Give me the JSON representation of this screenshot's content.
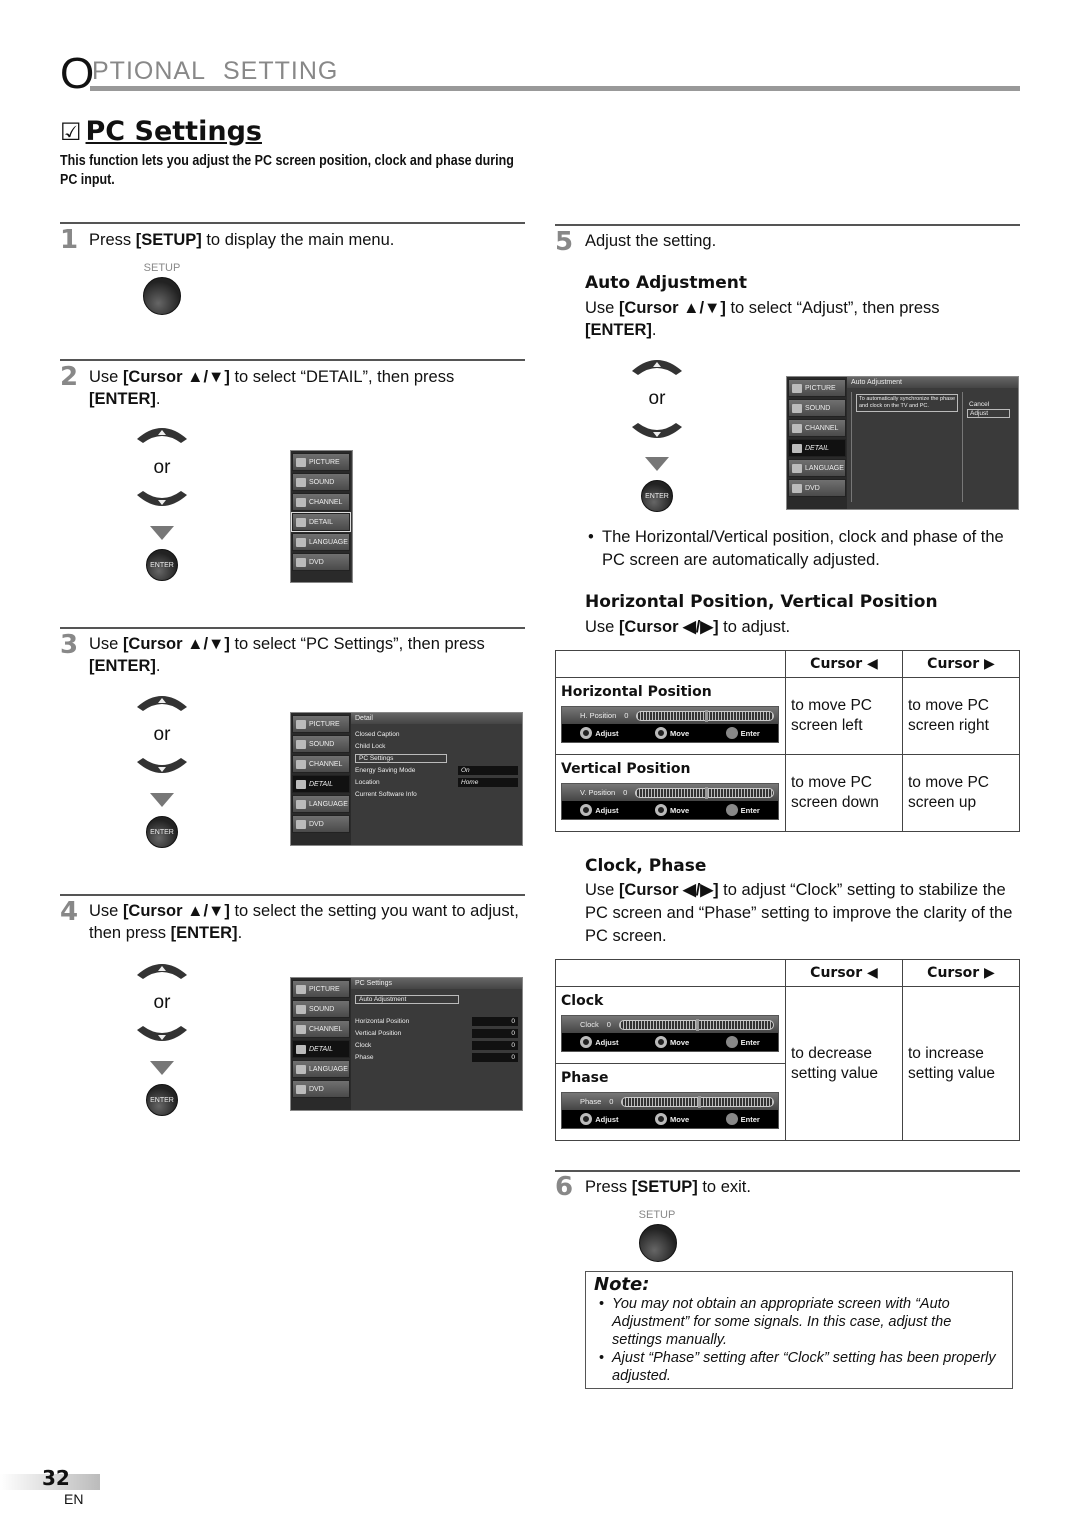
{
  "header": {
    "section_initial": "O",
    "section_rest": "PTIONAL SETTING"
  },
  "page": {
    "title_check": "☑",
    "title": "PC Settings",
    "intro": "This function lets you adjust the PC screen position, clock and phase during PC input.",
    "number": "32",
    "language": "EN"
  },
  "remote": {
    "setup_label": "SETUP",
    "or": "or",
    "enter_label": "ENTER"
  },
  "steps": [
    {
      "num": "1",
      "pre": "Press ",
      "key": "[SETUP]",
      "post": " to display the main menu."
    },
    {
      "num": "2",
      "pre": "Use ",
      "key": "[Cursor ▲/▼]",
      "post": " to select “DETAIL”, then press ",
      "key2": "[ENTER]",
      "post2": "."
    },
    {
      "num": "3",
      "pre": "Use ",
      "key": "[Cursor ▲/▼]",
      "post": " to select “PC Settings”, then press ",
      "key2": "[ENTER]",
      "post2": "."
    },
    {
      "num": "4",
      "pre": "Use ",
      "key": "[Cursor ▲/▼]",
      "post": " to select the setting you want to adjust, then press ",
      "key2": "[ENTER]",
      "post2": "."
    },
    {
      "num": "5",
      "text": "Adjust the setting."
    },
    {
      "num": "6",
      "pre": "Press ",
      "key": "[SETUP]",
      "post": " to exit."
    }
  ],
  "tv_menu": {
    "side": [
      "PICTURE",
      "SOUND",
      "CHANNEL",
      "DETAIL",
      "LANGUAGE",
      "DVD"
    ],
    "detail": {
      "title": "Detail",
      "items": [
        "Closed Caption",
        "Child Lock",
        "PC Settings",
        "Energy Saving Mode",
        "Location",
        "Current Software Info"
      ],
      "energy_value": "On",
      "location_value": "Home"
    },
    "pc_settings": {
      "title": "PC Settings",
      "auto": "Auto Adjustment",
      "rows": [
        {
          "label": "Horizontal Position",
          "value": "0"
        },
        {
          "label": "Vertical Position",
          "value": "0"
        },
        {
          "label": "Clock",
          "value": "0"
        },
        {
          "label": "Phase",
          "value": "0"
        }
      ]
    },
    "auto_adj": {
      "title": "Auto Adjustment",
      "desc": "To automatically synchronize the phase and clock on the TV and PC.",
      "cancel": "Cancel",
      "adjust": "Adjust"
    }
  },
  "auto_adjustment": {
    "heading": "Auto Adjustment",
    "pre": "Use ",
    "key": "[Cursor ▲/▼]",
    "post": " to select “Adjust”, then press ",
    "key2": "[ENTER]",
    "post2": ".",
    "bullet": "The Horizontal/Vertical position, clock and phase of the PC screen are automatically adjusted."
  },
  "position": {
    "heading": "Horizontal Position, Vertical Position",
    "pre": "Use ",
    "key": "[Cursor ◀/▶]",
    "post": " to adjust.",
    "col_left": "Cursor ◀",
    "col_right": "Cursor ▶",
    "rows": [
      {
        "label": "Horizontal Position",
        "osd_label": "H. Position",
        "osd_value": "0",
        "left": "to move PC screen left",
        "right": "to move PC screen right"
      },
      {
        "label": "Vertical Position",
        "osd_label": "V. Position",
        "osd_value": "0",
        "left": "to move PC screen down",
        "right": "to move PC screen up"
      }
    ]
  },
  "clock_phase": {
    "heading": "Clock, Phase",
    "pre": "Use ",
    "key": "[Cursor ◀/▶]",
    "post": " to adjust “Clock” setting to stabilize the PC screen and “Phase” setting to improve the clarity of the PC screen.",
    "col_left": "Cursor ◀",
    "col_right": "Cursor ▶",
    "rows": [
      {
        "label": "Clock",
        "osd_label": "Clock",
        "osd_value": "0"
      },
      {
        "label": "Phase",
        "osd_label": "Phase",
        "osd_value": "0"
      }
    ],
    "left": "to decrease setting value",
    "right": "to increase setting value"
  },
  "osd_hints": {
    "adjust": "Adjust",
    "move": "Move",
    "enter": "Enter"
  },
  "note": {
    "title": "Note:",
    "items": [
      "You may not obtain an appropriate screen with “Auto Adjustment” for some signals. In this case, adjust the settings manually.",
      "Ajust “Phase” setting after “Clock” setting has been properly adjusted."
    ]
  }
}
